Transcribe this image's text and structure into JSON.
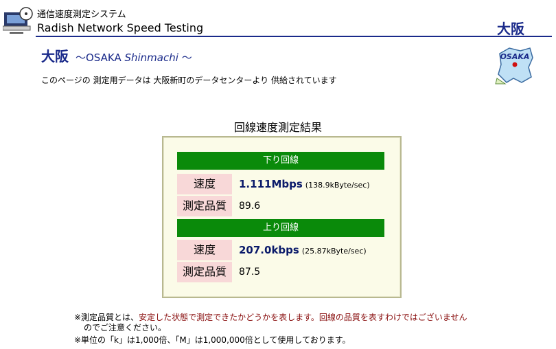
{
  "header": {
    "subtitle": "通信速度測定システム",
    "title": "Radish Network Speed Testing",
    "region": "大阪"
  },
  "city": {
    "name": "大阪",
    "sub_prefix": "～OSAKA ",
    "sub_italic": "Shinmachi",
    "sub_suffix": " ～",
    "description": "このページの 測定用データは 大阪新町のデータセンターより 供給されています",
    "map_label": "OSAKA"
  },
  "result": {
    "heading": "回線速度測定結果",
    "download": {
      "band_label": "下り回線",
      "speed_label": "速度",
      "speed_value": "1.111Mbps",
      "speed_detail": "(138.9kByte/sec)",
      "quality_label": "測定品質",
      "quality_value": "89.6"
    },
    "upload": {
      "band_label": "上り回線",
      "speed_label": "速度",
      "speed_value": "207.0kbps",
      "speed_detail": "(25.87kByte/sec)",
      "quality_label": "測定品質",
      "quality_value": "87.5"
    }
  },
  "notes": {
    "note1_a": "※測定品質とは、",
    "note1_b": "安定した状態で測定できたかどうかを表します。回線の品質を表すわけではございません",
    "note1_c": "のでご注意ください。",
    "note2": "※単位の「k」は1,000倍、「M」は1,000,000倍として使用しております。"
  },
  "colors": {
    "navy": "#1a2a8a",
    "green_band": "#0a8a0a",
    "pink_cell": "#f8d8d8",
    "panel_bg": "#fbfbe8",
    "note_red": "#8a1010"
  }
}
